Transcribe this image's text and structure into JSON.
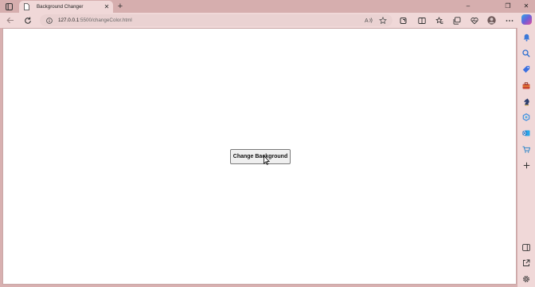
{
  "browser": {
    "tab": {
      "title": "Background Changer",
      "close": "✕"
    },
    "new_tab": "+",
    "window_controls": {
      "minimize": "–",
      "restore": "❐",
      "close": "✕"
    },
    "address": {
      "host": "127.0.0.1",
      "path": ":5500/changeColor.html"
    },
    "colors": {
      "frame": "#d6aeae",
      "toolbar": "#f0d8d8",
      "address": "#ead2d2"
    }
  },
  "page": {
    "button_label": "Change Background",
    "background": "#ffffff"
  },
  "icons": {
    "tab_actions": "tab-actions-icon",
    "back": "back-arrow-icon",
    "reload": "reload-icon",
    "info": "info-icon",
    "read_aloud": "read-aloud-icon",
    "favorite": "star-icon",
    "sidebar_items": [
      "bell-icon",
      "search-icon",
      "tag-icon",
      "toolbox-icon",
      "chess-icon",
      "copilot-app-icon",
      "outlook-icon",
      "shopping-icon",
      "plus-icon"
    ]
  }
}
